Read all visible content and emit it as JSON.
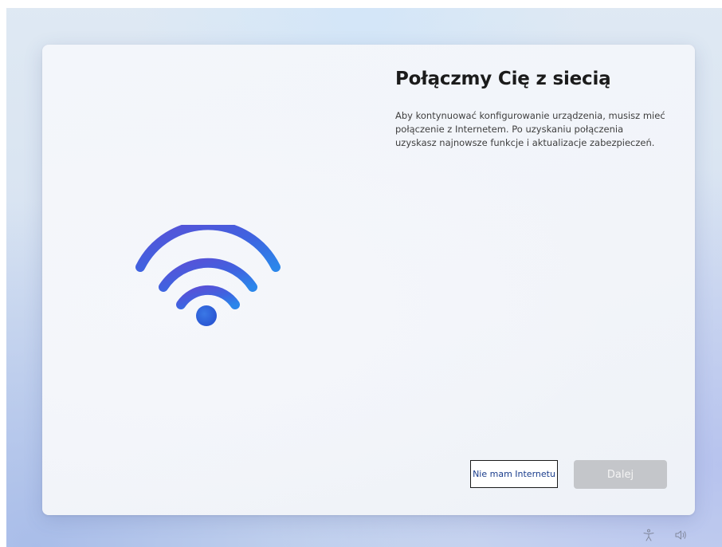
{
  "setup": {
    "title": "Połączmy Cię z siecią",
    "description": "Aby kontynuować konfigurowanie urządzenia, musisz mieć połączenie z Internetem. Po uzyskaniu połączenia uzyskasz najnowsze funkcje i aktualizacje zabezpieczeń.",
    "illustration_icon": "wifi-icon",
    "buttons": {
      "no_internet_label": "Nie mam Internetu",
      "next_label": "Dalej",
      "next_enabled": false
    }
  },
  "taskbar": {
    "icons": [
      "accessibility-icon",
      "volume-icon"
    ]
  },
  "colors": {
    "accent_blue": "#2f6fde",
    "accent_indigo": "#4f52d8",
    "link_text": "#1a3d8c",
    "disabled_button": "#c4c6ca"
  }
}
